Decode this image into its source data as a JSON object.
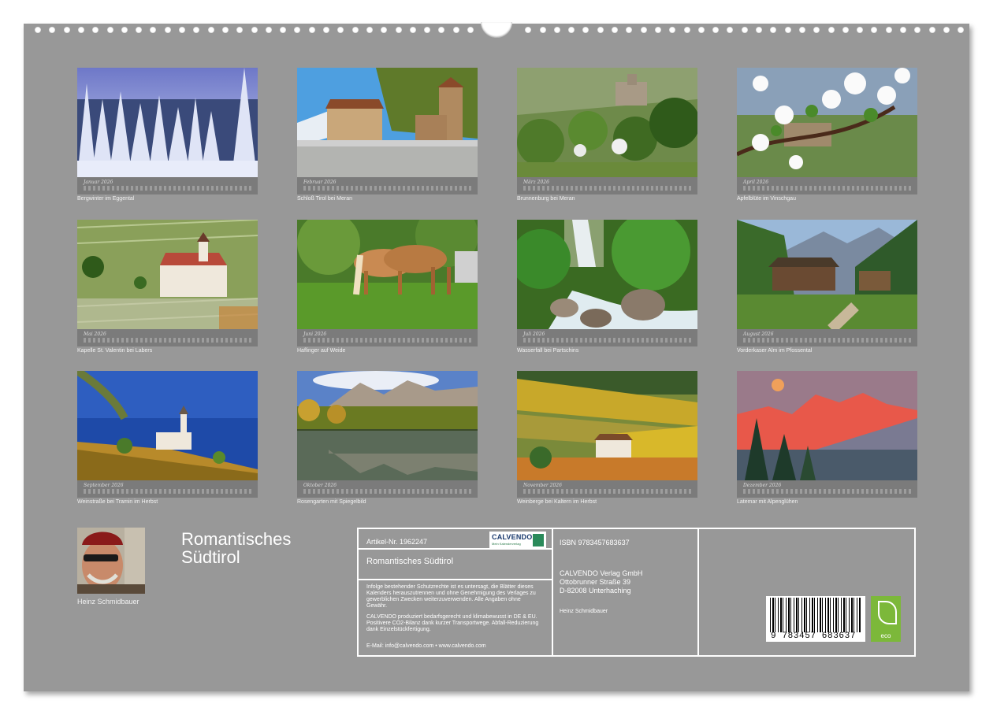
{
  "calendar": {
    "months": [
      {
        "label": "Januar 2026",
        "caption": "Bergwinter im Eggental"
      },
      {
        "label": "Februar 2026",
        "caption": "Schloß Tirol bei Meran"
      },
      {
        "label": "März 2026",
        "caption": "Brunnenburg bei Meran"
      },
      {
        "label": "April 2026",
        "caption": "Apfelblüte im Vinschgau"
      },
      {
        "label": "Mai 2026",
        "caption": "Kapelle St. Valentin bei Labers"
      },
      {
        "label": "Juni 2026",
        "caption": "Haflinger auf Weide"
      },
      {
        "label": "Juli 2026",
        "caption": "Wasserfall bei Partschins"
      },
      {
        "label": "August 2026",
        "caption": "Vorderkaser Alm im Pfossental"
      },
      {
        "label": "September 2026",
        "caption": "Weinstraße bei Tramin im Herbst"
      },
      {
        "label": "Oktober 2026",
        "caption": "Rosengarten mit Spiegelbild"
      },
      {
        "label": "November 2026",
        "caption": "Weinberge bei Kaltern im Herbst"
      },
      {
        "label": "Dezember 2026",
        "caption": "Latemar mit Alpenglühen"
      }
    ]
  },
  "author": {
    "name": "Heinz Schmidbauer"
  },
  "title_line1": "Romantisches",
  "title_line2": "Südtirol",
  "info": {
    "article": "Artikel-Nr. 1962247",
    "logo_text": "CALVENDO",
    "logo_sub": "Mein Kalenderverlag",
    "title": "Romantisches Südtirol",
    "legal": "Infolge bestehender Schutzrechte ist es untersagt, die Blätter dieses Kalenders herauszutrennen und ohne Genehmigung des Verlages zu gewerblichen Zwecken weiterzuverwenden. Alle Angaben ohne Gewähr.",
    "eco_text": "CALVENDO produziert bedarfsgerecht und klimabewusst in DE & EU. Positivere CO2-Bilanz dank kurzer Transportwege. Abfall-Reduzierung dank Einzelstückfertigung.",
    "contact": "E-Mail: info@calvendo.com • www.calvendo.com",
    "isbn": "ISBN 9783457683637",
    "publisher1": "CALVENDO Verlag GmbH",
    "publisher2": "Ottobrunner Straße 39",
    "publisher3": "D-82008 Unterhaching",
    "author_small": "Heinz Schmidbauer",
    "barcode_number": "9 783457 683637",
    "eco_label": "eco"
  }
}
